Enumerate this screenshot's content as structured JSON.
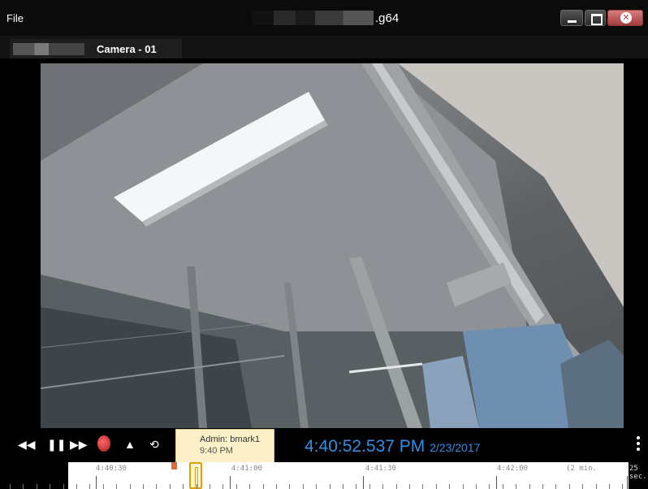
{
  "window": {
    "menu_file": "File",
    "title": ".g64"
  },
  "tab": {
    "label": "Camera - 01"
  },
  "controls": {
    "rewind_icon": "fast-rewind-icon",
    "pause_icon": "pause-icon",
    "forward_icon": "fast-forward-icon",
    "speed_icon": "speed-dial-icon",
    "slow_icon": "turtle-icon",
    "loop_icon": "loop-icon",
    "time": "4:40:52.537 PM",
    "date": "2/23/2017"
  },
  "tooltip": {
    "line1": "Admin: bmark1",
    "line2": "9:40 PM"
  },
  "timeline": {
    "labels": [
      "4:40:30",
      "4:41:00",
      "4:41:30",
      "4:42:00"
    ],
    "range_label": "(2 min.",
    "zoom_label": "25 sec."
  },
  "colors": {
    "time_accent": "#2f8fe6",
    "bookmark": "#e36b2d",
    "playhead": "#e0a000",
    "tooltip_bg": "#fbf0c8"
  }
}
